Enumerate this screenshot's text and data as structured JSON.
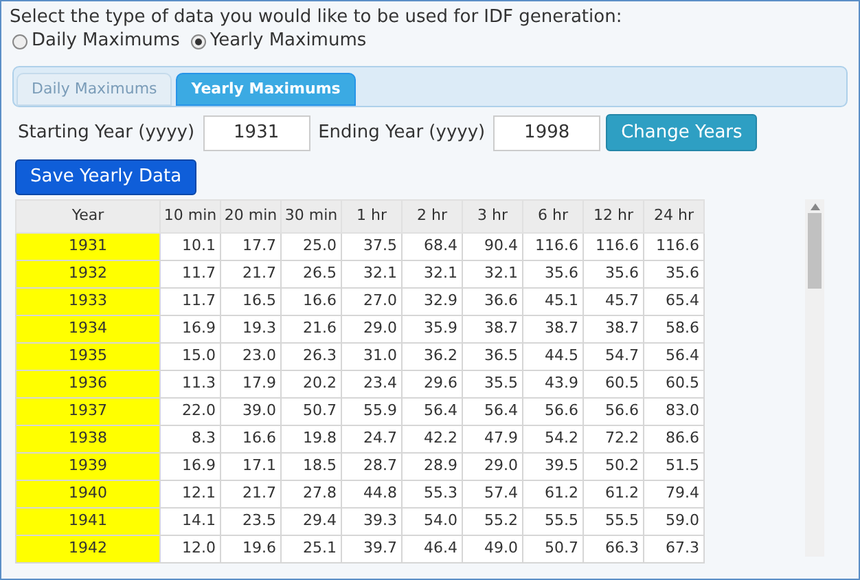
{
  "prompt": "Select the type of data you would like to be used for IDF generation:",
  "radios": [
    {
      "label": "Daily Maximums",
      "selected": false
    },
    {
      "label": "Yearly Maximums",
      "selected": true
    }
  ],
  "tabs": [
    {
      "label": "Daily Maximums",
      "selected": false
    },
    {
      "label": "Yearly Maximums",
      "selected": true
    }
  ],
  "start": {
    "label": "Starting Year (yyyy)",
    "value": "1931"
  },
  "end": {
    "label": "Ending Year (yyyy)",
    "value": "1998"
  },
  "change_button": "Change Years",
  "save_button": "Save Yearly Data",
  "table": {
    "columns": [
      "Year",
      "10 min",
      "20 min",
      "30 min",
      "1 hr",
      "2 hr",
      "3 hr",
      "6 hr",
      "12 hr",
      "24 hr"
    ],
    "rows": [
      [
        "1931",
        "10.1",
        "17.7",
        "25.0",
        "37.5",
        "68.4",
        "90.4",
        "116.6",
        "116.6",
        "116.6"
      ],
      [
        "1932",
        "11.7",
        "21.7",
        "26.5",
        "32.1",
        "32.1",
        "32.1",
        "35.6",
        "35.6",
        "35.6"
      ],
      [
        "1933",
        "11.7",
        "16.5",
        "16.6",
        "27.0",
        "32.9",
        "36.6",
        "45.1",
        "45.7",
        "65.4"
      ],
      [
        "1934",
        "16.9",
        "19.3",
        "21.6",
        "29.0",
        "35.9",
        "38.7",
        "38.7",
        "38.7",
        "58.6"
      ],
      [
        "1935",
        "15.0",
        "23.0",
        "26.3",
        "31.0",
        "36.2",
        "36.5",
        "44.5",
        "54.7",
        "56.4"
      ],
      [
        "1936",
        "11.3",
        "17.9",
        "20.2",
        "23.4",
        "29.6",
        "35.5",
        "43.9",
        "60.5",
        "60.5"
      ],
      [
        "1937",
        "22.0",
        "39.0",
        "50.7",
        "55.9",
        "56.4",
        "56.4",
        "56.6",
        "56.6",
        "83.0"
      ],
      [
        "1938",
        "8.3",
        "16.6",
        "19.8",
        "24.7",
        "42.2",
        "47.9",
        "54.2",
        "72.2",
        "86.6"
      ],
      [
        "1939",
        "16.9",
        "17.1",
        "18.5",
        "28.7",
        "28.9",
        "29.0",
        "39.5",
        "50.2",
        "51.5"
      ],
      [
        "1940",
        "12.1",
        "21.7",
        "27.8",
        "44.8",
        "55.3",
        "57.4",
        "61.2",
        "61.2",
        "79.4"
      ],
      [
        "1941",
        "14.1",
        "23.5",
        "29.4",
        "39.3",
        "54.0",
        "55.2",
        "55.5",
        "55.5",
        "59.0"
      ],
      [
        "1942",
        "12.0",
        "19.6",
        "25.1",
        "39.7",
        "46.4",
        "49.0",
        "50.7",
        "66.3",
        "67.3"
      ]
    ]
  }
}
